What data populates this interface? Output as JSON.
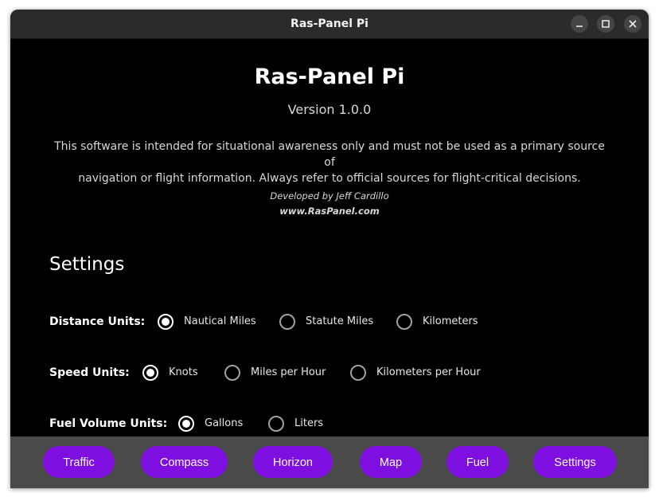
{
  "window": {
    "title": "Ras-Panel Pi"
  },
  "about": {
    "app_name": "Ras-Panel Pi",
    "version": "Version 1.0.0",
    "disclaimer_line1": "This software is intended for situational awareness only and must not be used as a primary source of",
    "disclaimer_line2": "navigation or flight information. Always refer to official sources for flight-critical decisions.",
    "developer": "Developed by Jeff Cardillo",
    "website": "www.RasPanel.com"
  },
  "settings": {
    "title": "Settings",
    "distance": {
      "label": "Distance Units:",
      "options": [
        "Nautical Miles",
        "Statute Miles",
        "Kilometers"
      ],
      "selected": "Nautical Miles"
    },
    "speed": {
      "label": "Speed Units:",
      "options": [
        "Knots",
        "Miles per Hour",
        "Kilometers per Hour"
      ],
      "selected": "Knots"
    },
    "fuel": {
      "label": "Fuel Volume Units:",
      "options": [
        "Gallons",
        "Liters"
      ],
      "selected": "Gallons"
    }
  },
  "nav": {
    "items": [
      "Traffic",
      "Compass",
      "Horizon",
      "Map",
      "Fuel",
      "Settings"
    ]
  },
  "colors": {
    "accent": "#7e0fe0",
    "background": "#000000",
    "navbar": "#4a4a4a",
    "titlebar": "#2b2b2b"
  }
}
